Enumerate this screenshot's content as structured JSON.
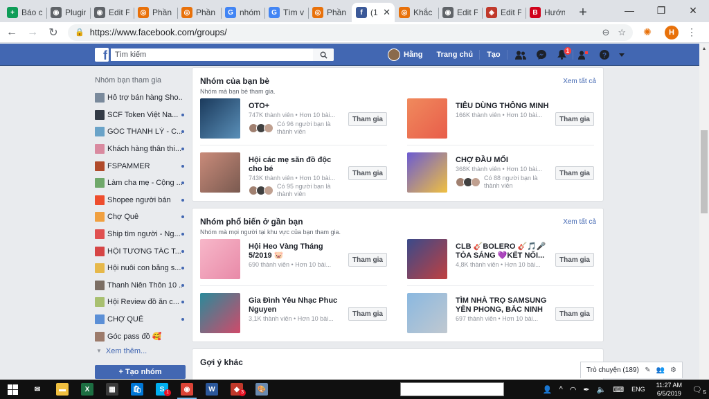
{
  "browser": {
    "tabs": [
      {
        "title": "Báo c",
        "color": "#0f9d58",
        "glyph": "+"
      },
      {
        "title": "Plugin",
        "color": "#5f6368",
        "glyph": "◉"
      },
      {
        "title": "Edit P",
        "color": "#5f6368",
        "glyph": "◉"
      },
      {
        "title": "Phần",
        "color": "#e8710a",
        "glyph": "◎"
      },
      {
        "title": "Phần",
        "color": "#e8710a",
        "glyph": "◎"
      },
      {
        "title": "nhóm",
        "color": "#4285f4",
        "glyph": "G"
      },
      {
        "title": "Tìm v",
        "color": "#4285f4",
        "glyph": "G"
      },
      {
        "title": "Phần",
        "color": "#e8710a",
        "glyph": "◎"
      },
      {
        "title": "(1",
        "color": "#3b5998",
        "glyph": "f",
        "active": true
      },
      {
        "title": "Khắc",
        "color": "#e8710a",
        "glyph": "◎"
      },
      {
        "title": "Edit P",
        "color": "#5f6368",
        "glyph": "◉"
      },
      {
        "title": "Edit P",
        "color": "#c0392b",
        "glyph": "◈"
      },
      {
        "title": "Hướn",
        "color": "#d0021b",
        "glyph": "B"
      }
    ],
    "url": "https://www.facebook.com/groups/",
    "profile_initial": "H"
  },
  "fb": {
    "search_placeholder": "Tìm kiếm",
    "user_name": "Hằng",
    "home": "Trang chủ",
    "create": "Tạo",
    "notif_count": "1"
  },
  "sidebar": {
    "title": "Nhóm bạn tham gia",
    "items": [
      {
        "label": "Hỗ trợ bán hàng Sho...",
        "color": "#7a8a9c",
        "dot": false
      },
      {
        "label": "SCF Token Việt Na...",
        "color": "#333a45",
        "dot": true
      },
      {
        "label": "GÓC THANH LÝ - C...",
        "color": "#6aa3c8",
        "dot": true
      },
      {
        "label": "Khách hàng thân thi...",
        "color": "#d98aa0",
        "dot": true
      },
      {
        "label": "FSPAMMER",
        "color": "#b04a2a",
        "dot": true
      },
      {
        "label": "Làm cha mẹ - Cộng ...",
        "color": "#6fa86a",
        "dot": true
      },
      {
        "label": "Shopee người bán",
        "color": "#ee4d2d",
        "dot": true
      },
      {
        "label": "Chợ Quê",
        "color": "#f0a040",
        "dot": true
      },
      {
        "label": "Ship tìm người - Ng...",
        "color": "#e05050",
        "dot": true
      },
      {
        "label": "HỘI TƯƠNG TÁC T...",
        "color": "#d64545",
        "dot": true
      },
      {
        "label": "Hội nuôi con bằng s...",
        "color": "#e6b84a",
        "dot": true
      },
      {
        "label": "Thanh Niên Thôn 10 ...",
        "color": "#7b6e64",
        "dot": true
      },
      {
        "label": "Hội Review đồ ăn c...",
        "color": "#a8c070",
        "dot": true
      },
      {
        "label": "CHỢ QUÊ",
        "color": "#5b8fd6",
        "dot": true
      },
      {
        "label": "Góc pass đồ 🥰",
        "color": "#9c7b6b",
        "dot": false
      }
    ],
    "see_more": "Xem thêm...",
    "new_group": "+ Tạo nhóm"
  },
  "friends_groups": {
    "title": "Nhóm của bạn bè",
    "subtitle": "Nhóm mà bạn bè tham gia.",
    "see_all": "Xem tất cả",
    "groups": [
      {
        "name": "OTO+",
        "meta": "747K thành viên • Hơn 10 bài...",
        "friends": "Có 96 người bạn là thành viên",
        "cover": [
          "#1b3a5c",
          "#5a8fb8"
        ],
        "join": "Tham gia"
      },
      {
        "name": "TIÊU DÙNG THÔNG MINH",
        "meta": "166K thành viên • Hơn 10 bài...",
        "friends": "",
        "cover": [
          "#f08a5d",
          "#e85d4a"
        ],
        "join": "Tham gia"
      },
      {
        "name": "Hội các mẹ săn đồ độc cho bé",
        "meta": "743K thành viên • Hơn 10 bài...",
        "friends": "Có 95 người bạn là thành viên",
        "cover": [
          "#c98b7a",
          "#7a5a50"
        ],
        "join": "Tham gia"
      },
      {
        "name": "CHỢ ĐẦU MỐI",
        "meta": "368K thành viên • Hơn 10 bài...",
        "friends": "Có 88 người bạn là thành viên",
        "cover": [
          "#6b5bd2",
          "#f0c040"
        ],
        "join": "Tham gia"
      }
    ]
  },
  "nearby_groups": {
    "title": "Nhóm phổ biến ở gần bạn",
    "subtitle": "Nhóm mà mọi người tại khu vực của bạn tham gia.",
    "see_all": "Xem tất cả",
    "groups": [
      {
        "name": "Hội Heo Vàng Tháng 5/2019 🐷",
        "meta": "690 thành viên • Hơn 10 bài...",
        "cover": [
          "#f7b7c9",
          "#e88aa8"
        ],
        "join": "Tham gia"
      },
      {
        "name": "CLB 🎸BOLERO 🎸🎵🎤 TỎA SÁNG 💜KẾT NỐI...",
        "meta": "4,8K thành viên • Hơn 10 bài...",
        "cover": [
          "#3a4a8a",
          "#c04040"
        ],
        "join": "Tham gia"
      },
      {
        "name": "Gia Đình Yêu Nhạc Phuc Nguyen",
        "meta": "3,1K thành viên • Hơn 10 bài...",
        "cover": [
          "#2a8a9a",
          "#d04a6a"
        ],
        "join": "Tham gia"
      },
      {
        "name": "TÌM NHÀ TRỌ SAMSUNG YÊN PHONG, BẮC NINH",
        "meta": "697 thành viên • Hơn 10 bài...",
        "cover": [
          "#8ab8e0",
          "#c0c8d0"
        ],
        "join": "Tham gia"
      }
    ]
  },
  "other": {
    "title": "Gợi ý khác"
  },
  "chat": {
    "label": "Trò chuyện (189)"
  },
  "taskbar": {
    "time": "11:27 AM",
    "date": "6/5/2019",
    "lang": "ENG",
    "notif": "5",
    "apps": [
      {
        "name": "mail",
        "color": "#ffffff",
        "glyph": "✉",
        "badge": ""
      },
      {
        "name": "explorer",
        "color": "#f0c040",
        "glyph": "▬",
        "badge": ""
      },
      {
        "name": "excel",
        "color": "#1d6f42",
        "glyph": "X",
        "badge": ""
      },
      {
        "name": "calculator",
        "color": "#3a3a3a",
        "glyph": "▦",
        "badge": ""
      },
      {
        "name": "store",
        "color": "#0078d7",
        "glyph": "🛍",
        "badge": ""
      },
      {
        "name": "skype",
        "color": "#00aff0",
        "glyph": "S",
        "badge": "1"
      },
      {
        "name": "chrome",
        "color": "#db4437",
        "glyph": "◉",
        "badge": ""
      },
      {
        "name": "word",
        "color": "#2b579a",
        "glyph": "W",
        "badge": ""
      },
      {
        "name": "app-red",
        "color": "#c0392b",
        "glyph": "◆",
        "badge": "3"
      },
      {
        "name": "paint",
        "color": "#6a8ab0",
        "glyph": "🎨",
        "badge": ""
      }
    ]
  }
}
